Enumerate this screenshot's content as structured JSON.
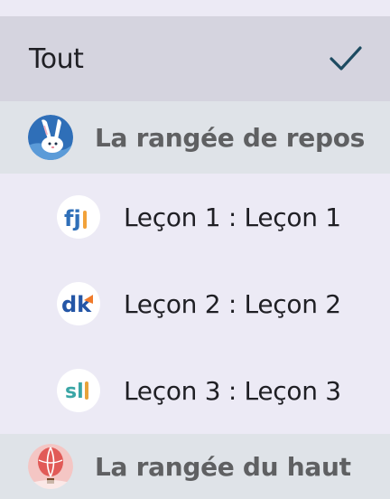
{
  "menu": {
    "all": {
      "label": "Tout",
      "selected": true
    },
    "groups": [
      {
        "label": "La rangée de repos",
        "avatar": "rabbit-avatar-icon",
        "lessons": [
          {
            "label": "Leçon 1 : Leçon 1",
            "badge_text": "fj",
            "badge": "fj-badge-icon"
          },
          {
            "label": "Leçon 2 : Leçon 2",
            "badge_text": "dk",
            "badge": "dk-badge-icon"
          },
          {
            "label": "Leçon 3 : Leçon 3",
            "badge_text": "sl",
            "badge": "sl-badge-icon"
          }
        ]
      },
      {
        "label": "La rangée du haut",
        "avatar": "hot-air-balloon-avatar-icon",
        "lessons": []
      }
    ]
  },
  "colors": {
    "background": "#eceaf5",
    "selected_bg": "#d5d4df",
    "group_bg": "#dfe3e8",
    "check": "#1d4b61",
    "group_text": "#5f6062"
  }
}
